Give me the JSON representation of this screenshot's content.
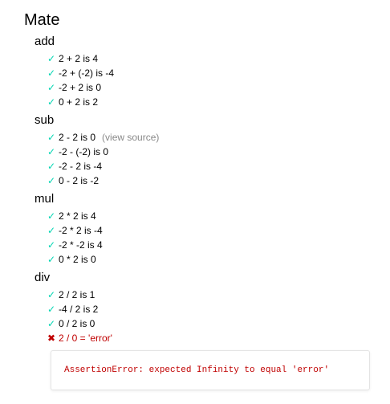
{
  "suite": {
    "title": "Mate",
    "groups": [
      {
        "title": "add",
        "tests": [
          {
            "title": "2 + 2 is 4",
            "status": "pass"
          },
          {
            "title": "-2 + (-2) is -4",
            "status": "pass"
          },
          {
            "title": "-2 + 2 is 0",
            "status": "pass"
          },
          {
            "title": "0 + 2 is 2",
            "status": "pass"
          }
        ]
      },
      {
        "title": "sub",
        "tests": [
          {
            "title": "2 - 2 is 0",
            "status": "pass",
            "view_source": "(view source)"
          },
          {
            "title": "-2 - (-2) is 0",
            "status": "pass"
          },
          {
            "title": "-2 - 2 is -4",
            "status": "pass"
          },
          {
            "title": "0 - 2 is -2",
            "status": "pass"
          }
        ]
      },
      {
        "title": "mul",
        "tests": [
          {
            "title": "2 * 2 is 4",
            "status": "pass"
          },
          {
            "title": "-2 * 2 is -4",
            "status": "pass"
          },
          {
            "title": "-2 * -2 is 4",
            "status": "pass"
          },
          {
            "title": "0 * 2 is 0",
            "status": "pass"
          }
        ]
      },
      {
        "title": "div",
        "tests": [
          {
            "title": "2 / 2 is 1",
            "status": "pass"
          },
          {
            "title": "-4 / 2 is 2",
            "status": "pass"
          },
          {
            "title": "0 / 2 is 0",
            "status": "pass"
          },
          {
            "title": "2 / 0 = 'error'",
            "status": "fail",
            "error": "AssertionError: expected Infinity to equal 'error'"
          }
        ]
      }
    ]
  },
  "icons": {
    "pass": "✓",
    "fail": "✖"
  },
  "colors": {
    "pass": "#00d6b2",
    "fail": "#c00000",
    "muted": "#888888"
  }
}
